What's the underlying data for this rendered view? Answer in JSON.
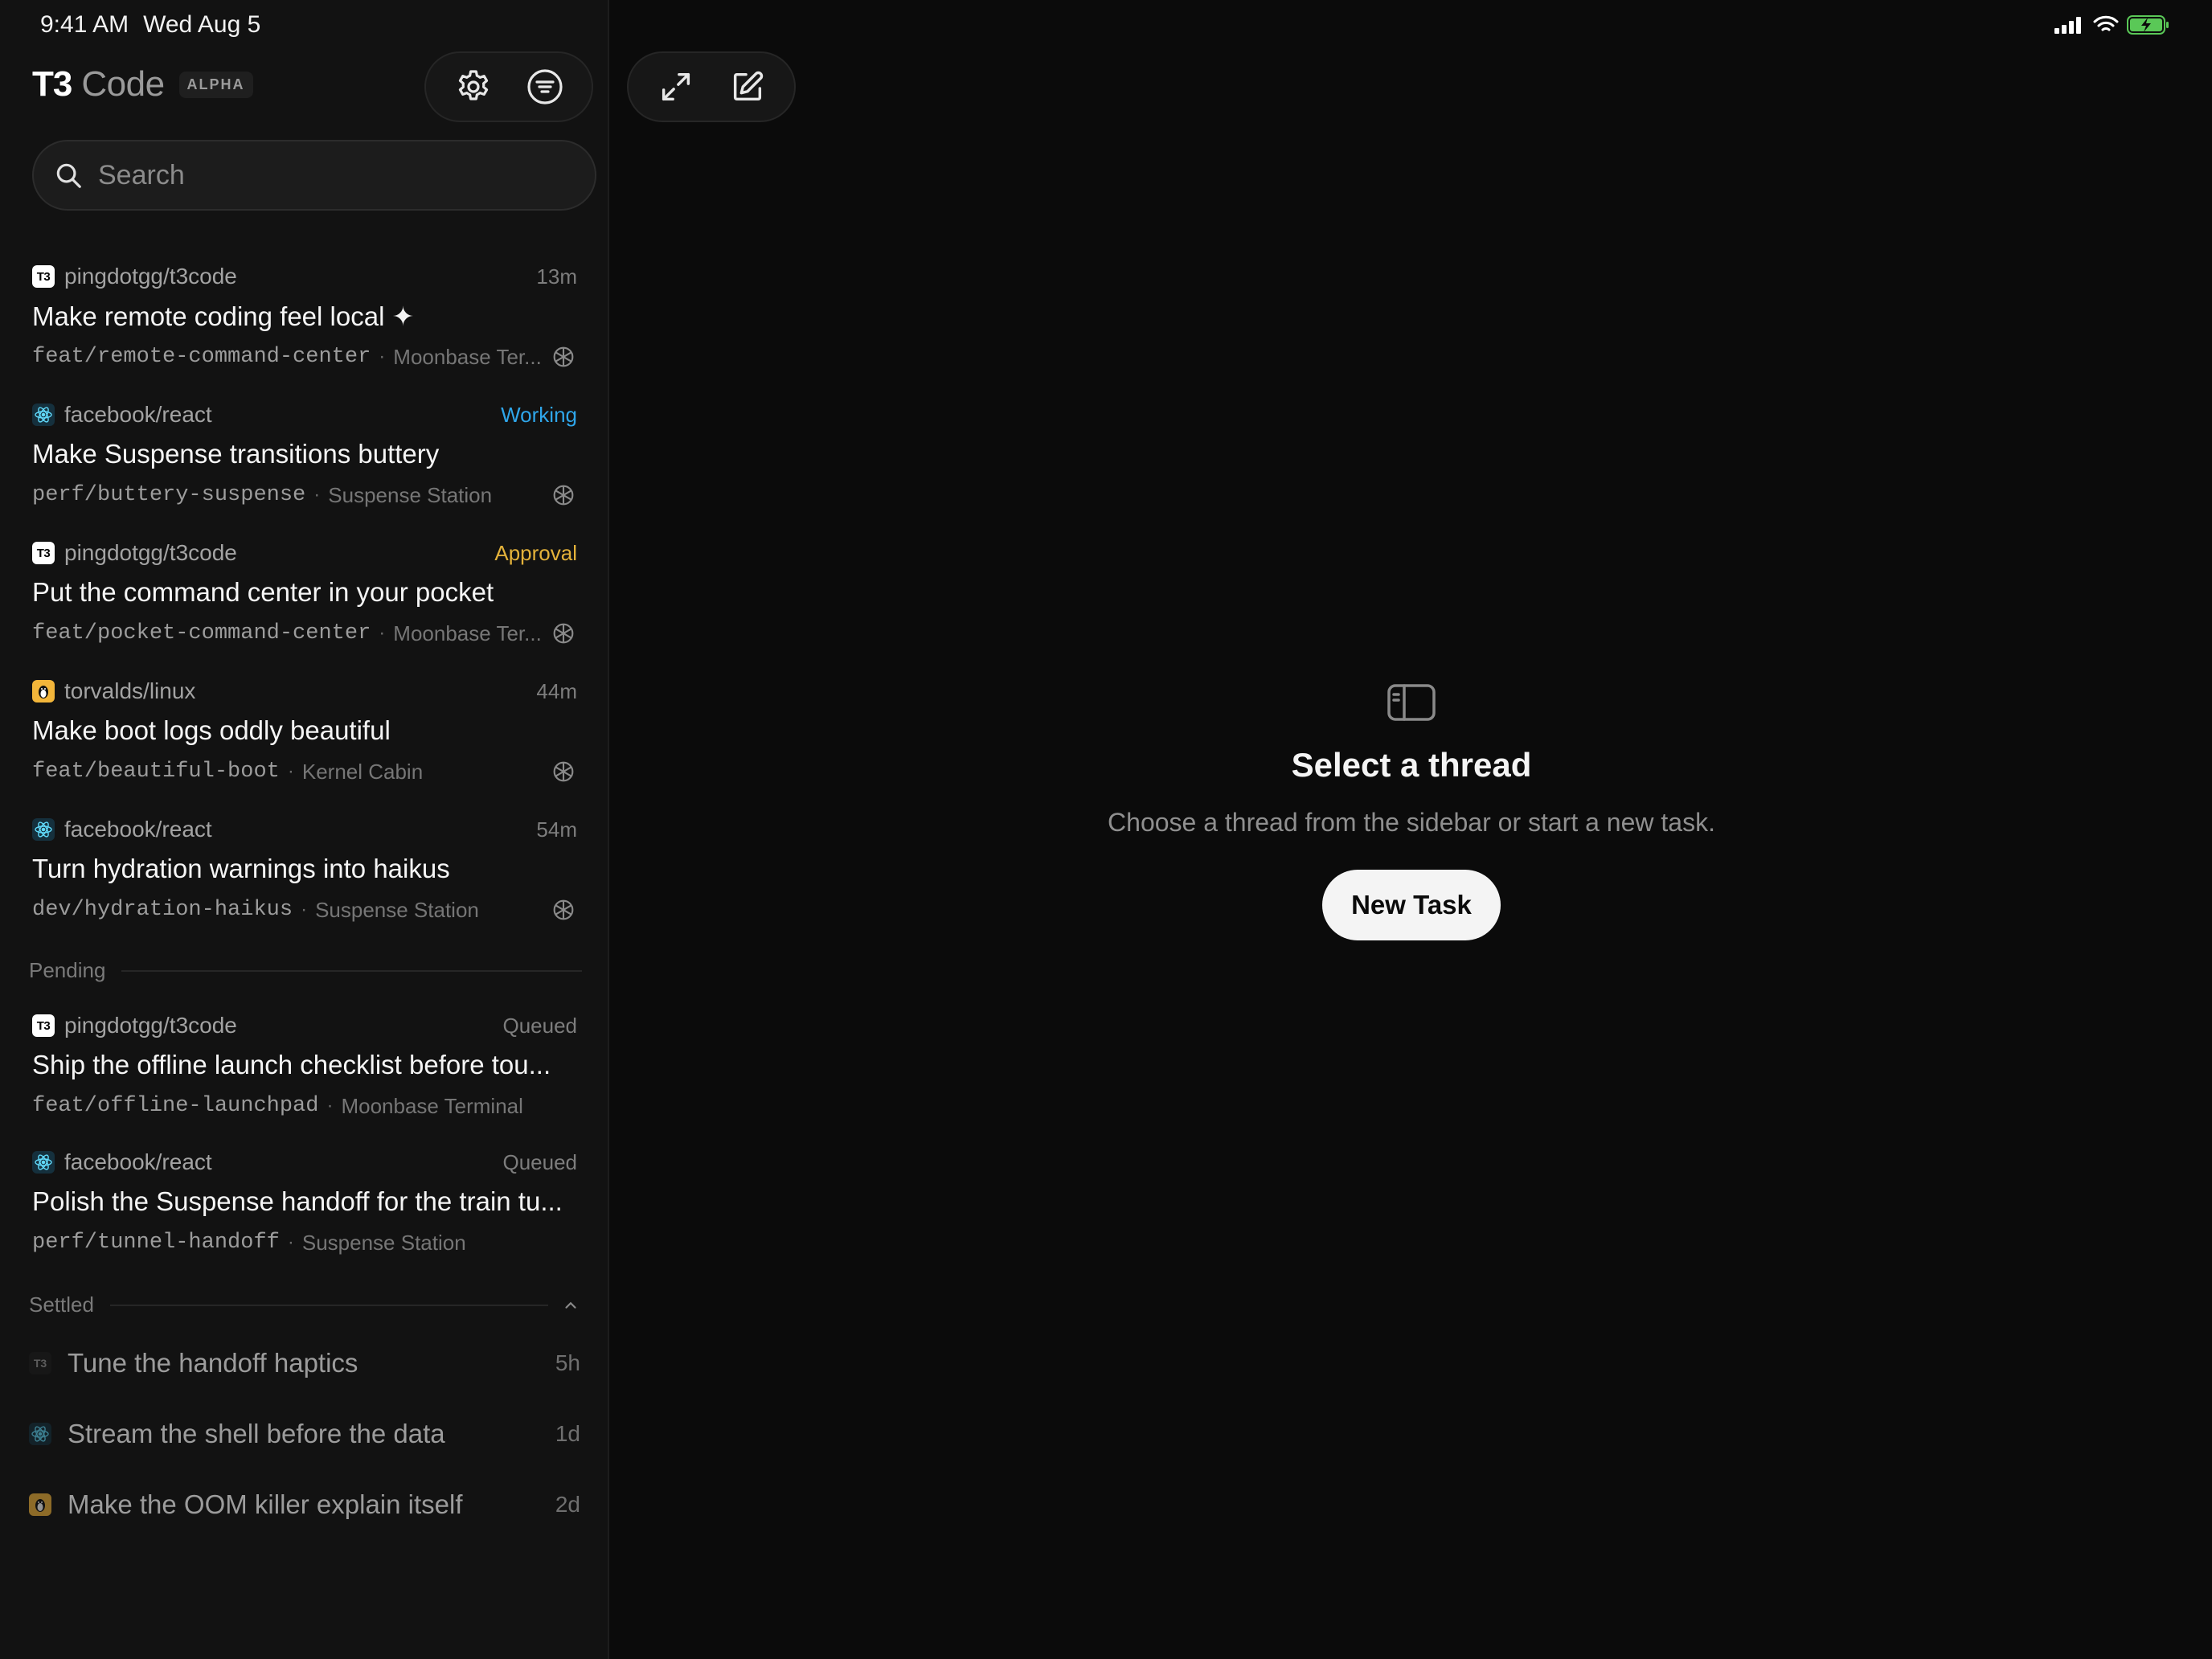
{
  "status_bar": {
    "time": "9:41 AM",
    "date": "Wed Aug 5",
    "icons": [
      "cellular-signal-icon",
      "wifi-icon",
      "battery-charging-icon"
    ]
  },
  "header": {
    "brand_t3": "T3",
    "brand_code": "Code",
    "badge": "ALPHA",
    "sidebar_actions": [
      "settings-gear-icon",
      "filter-icon"
    ],
    "main_actions": [
      "expand-icon",
      "compose-icon"
    ]
  },
  "search": {
    "placeholder": "Search",
    "value": ""
  },
  "threads": [
    {
      "repo_icon": "t3-logo-icon",
      "repo": "pingdotgg/t3code",
      "status": "13m",
      "title": "Make remote coding feel local ✦",
      "branch": "feat/remote-command-center",
      "host": "Moonbase Ter...",
      "agent_icon": "openai-icon"
    },
    {
      "repo_icon": "react-icon",
      "repo": "facebook/react",
      "status": "Working",
      "title": "Make Suspense transitions buttery",
      "branch": "perf/buttery-suspense",
      "host": "Suspense Station",
      "agent_icon": "openai-icon"
    },
    {
      "repo_icon": "t3-logo-icon",
      "repo": "pingdotgg/t3code",
      "status": "Approval",
      "title": "Put the command center in your pocket",
      "branch": "feat/pocket-command-center",
      "host": "Moonbase Ter...",
      "agent_icon": "openai-icon"
    },
    {
      "repo_icon": "linux-tux-icon",
      "repo": "torvalds/linux",
      "status": "44m",
      "title": "Make boot logs oddly beautiful",
      "branch": "feat/beautiful-boot",
      "host": "Kernel Cabin",
      "agent_icon": "openai-icon"
    },
    {
      "repo_icon": "react-icon",
      "repo": "facebook/react",
      "status": "54m",
      "title": "Turn hydration warnings into haikus",
      "branch": "dev/hydration-haikus",
      "host": "Suspense Station",
      "agent_icon": "openai-icon"
    }
  ],
  "pending": {
    "label": "Pending",
    "items": [
      {
        "repo_icon": "t3-logo-icon",
        "repo": "pingdotgg/t3code",
        "status": "Queued",
        "title": "Ship the offline launch checklist before tou...",
        "branch": "feat/offline-launchpad",
        "host": "Moonbase Terminal"
      },
      {
        "repo_icon": "react-icon",
        "repo": "facebook/react",
        "status": "Queued",
        "title": "Polish the Suspense handoff for the train tu...",
        "branch": "perf/tunnel-handoff",
        "host": "Suspense Station"
      }
    ]
  },
  "settled": {
    "label": "Settled",
    "items": [
      {
        "repo_icon": "t3-logo-icon",
        "title": "Tune the handoff haptics",
        "age": "5h"
      },
      {
        "repo_icon": "react-icon",
        "title": "Stream the shell before the data",
        "age": "1d"
      },
      {
        "repo_icon": "linux-tux-icon",
        "title": "Make the OOM killer explain itself",
        "age": "2d"
      }
    ]
  },
  "empty_state": {
    "icon": "sidebar-panel-icon",
    "title": "Select a thread",
    "description": "Choose a thread from the sidebar or start a new task.",
    "button": "New Task"
  },
  "colors": {
    "working": "#2fa6ea",
    "approval": "#e4b23a",
    "background": "#0b0b0b",
    "sidebar": "#121212"
  }
}
